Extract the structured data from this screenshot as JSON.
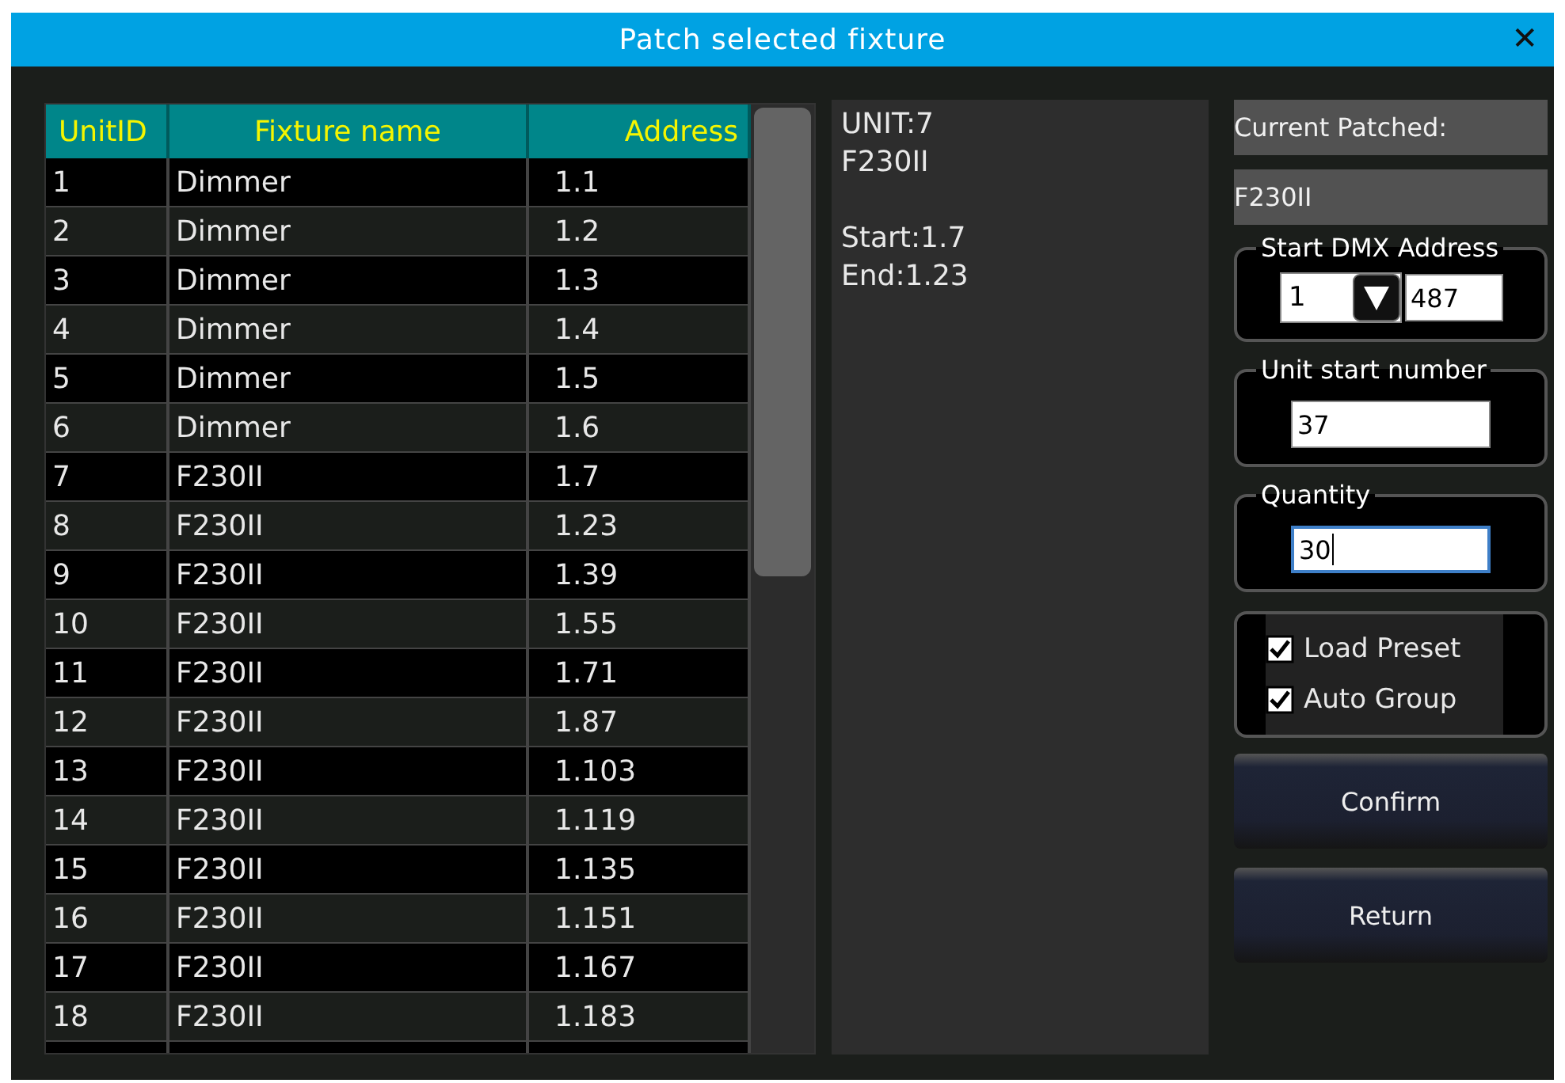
{
  "window": {
    "title": "Patch selected fixture",
    "close": "✕"
  },
  "table": {
    "columns": [
      "UnitID",
      "Fixture name",
      "Address"
    ],
    "rows": [
      {
        "unit": "1",
        "name": "Dimmer",
        "address": "1.1"
      },
      {
        "unit": "2",
        "name": "Dimmer",
        "address": "1.2"
      },
      {
        "unit": "3",
        "name": "Dimmer",
        "address": "1.3"
      },
      {
        "unit": "4",
        "name": "Dimmer",
        "address": "1.4"
      },
      {
        "unit": "5",
        "name": "Dimmer",
        "address": "1.5"
      },
      {
        "unit": "6",
        "name": "Dimmer",
        "address": "1.6"
      },
      {
        "unit": "7",
        "name": "F230II",
        "address": "1.7"
      },
      {
        "unit": "8",
        "name": "F230II",
        "address": "1.23"
      },
      {
        "unit": "9",
        "name": "F230II",
        "address": "1.39"
      },
      {
        "unit": "10",
        "name": "F230II",
        "address": "1.55"
      },
      {
        "unit": "11",
        "name": "F230II",
        "address": "1.71"
      },
      {
        "unit": "12",
        "name": "F230II",
        "address": "1.87"
      },
      {
        "unit": "13",
        "name": "F230II",
        "address": "1.103"
      },
      {
        "unit": "14",
        "name": "F230II",
        "address": "1.119"
      },
      {
        "unit": "15",
        "name": "F230II",
        "address": "1.135"
      },
      {
        "unit": "16",
        "name": "F230II",
        "address": "1.151"
      },
      {
        "unit": "17",
        "name": "F230II",
        "address": "1.167"
      },
      {
        "unit": "18",
        "name": "F230II",
        "address": "1.183"
      }
    ]
  },
  "info": {
    "blocks": [
      [
        "UNIT:7",
        "F230II"
      ],
      [
        "Start:1.7",
        "End:1.23"
      ]
    ]
  },
  "current_patched": {
    "label": "Current Patched:",
    "value": "F230II"
  },
  "start_dmx": {
    "label": "Start DMX Address",
    "universe": "1",
    "address": "487"
  },
  "unit_start": {
    "label": "Unit start number",
    "value": "37"
  },
  "quantity": {
    "label": "Quantity",
    "value": "30",
    "focused": true
  },
  "options": [
    {
      "label": "Load Preset",
      "checked": true
    },
    {
      "label": "Auto Group",
      "checked": true
    }
  ],
  "buttons": [
    "Confirm",
    "Return"
  ]
}
